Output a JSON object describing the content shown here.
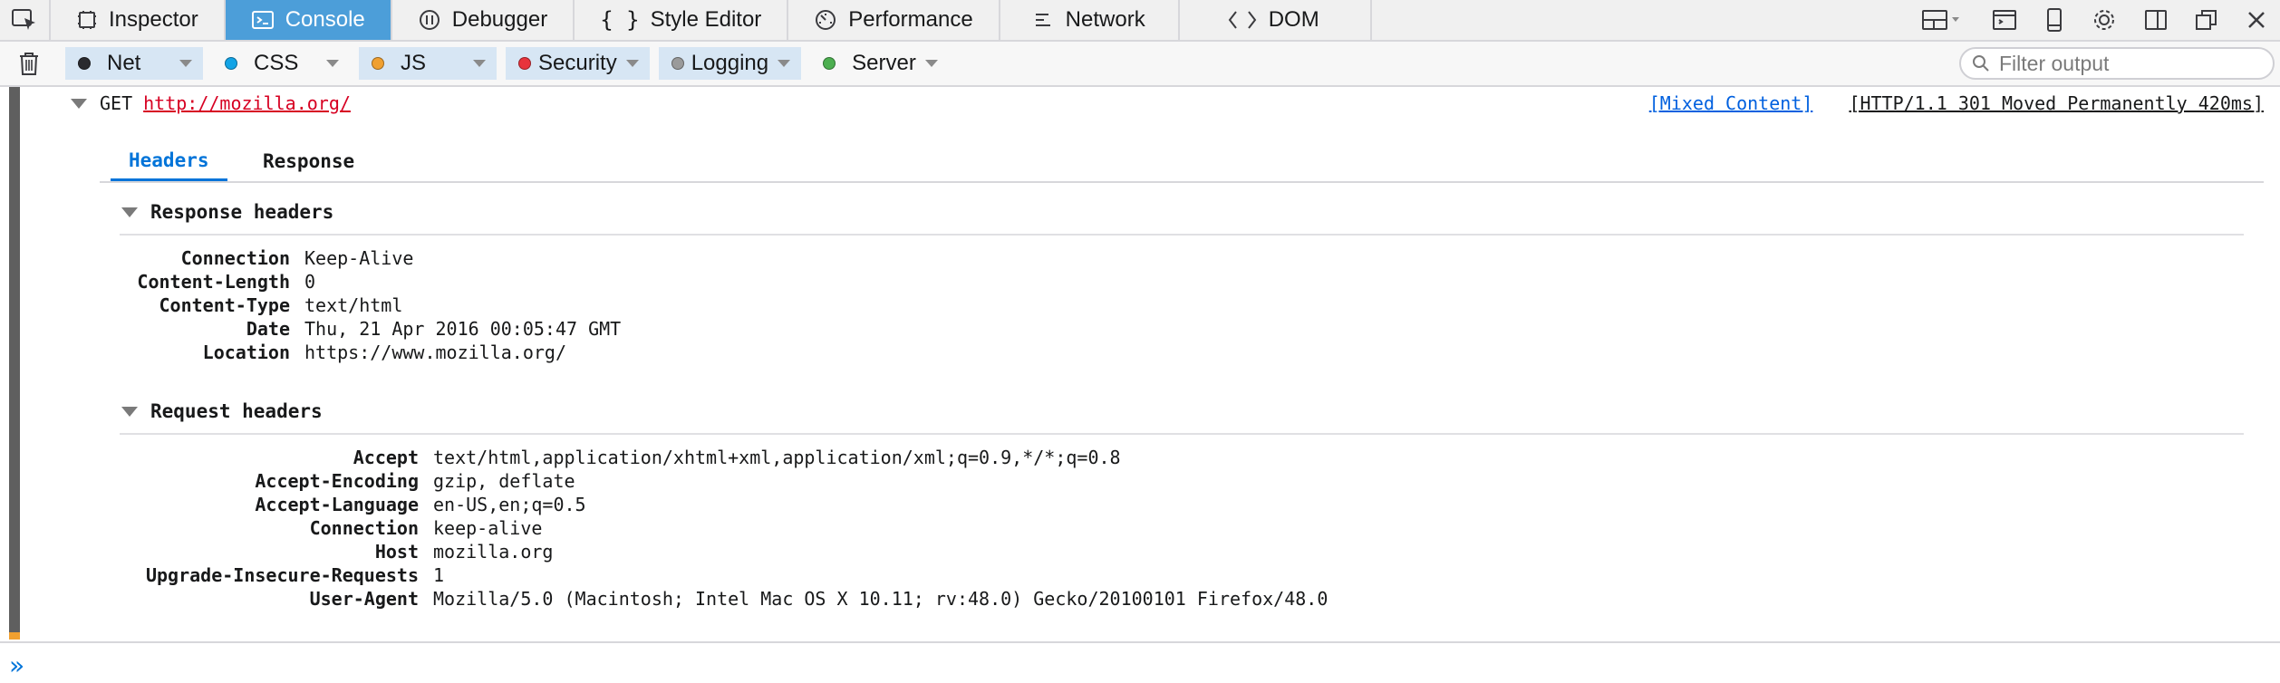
{
  "toolbar": {
    "tabs": [
      {
        "label": "Inspector",
        "icon": "inspector-icon"
      },
      {
        "label": "Console",
        "icon": "console-icon",
        "selected": true
      },
      {
        "label": "Debugger",
        "icon": "debugger-icon"
      },
      {
        "label": "Style Editor",
        "icon": "style-editor-icon"
      },
      {
        "label": "Performance",
        "icon": "performance-icon"
      },
      {
        "label": "Network",
        "icon": "network-icon"
      },
      {
        "label": "DOM",
        "icon": "dom-icon"
      }
    ],
    "right_icons": [
      "dock-layout-icon",
      "split-console-icon",
      "responsive-design-icon",
      "settings-icon",
      "dock-side-icon",
      "undock-window-icon",
      "close-icon"
    ],
    "accent_color": "#4c9ed9"
  },
  "filters": {
    "items": [
      {
        "label": "Net",
        "color": "#2a2a2e",
        "active": true
      },
      {
        "label": "CSS",
        "color": "#13a4e6",
        "active": false
      },
      {
        "label": "JS",
        "color": "#f0a030",
        "active": true
      },
      {
        "label": "Security",
        "color": "#e8333c",
        "active": true
      },
      {
        "label": "Logging",
        "color": "#9a9a9a",
        "active": true
      },
      {
        "label": "Server",
        "color": "#4caf50",
        "active": false
      }
    ],
    "search_placeholder": "Filter output"
  },
  "request": {
    "method": "GET",
    "url": "http://mozilla.org/",
    "mixed_content": "[Mixed Content]",
    "status": "[HTTP/1.1 301 Moved Permanently 420ms]"
  },
  "detail_tabs": {
    "headers": "Headers",
    "response": "Response"
  },
  "response_headers": {
    "title": "Response headers",
    "rows": [
      {
        "name": "Connection",
        "value": "Keep-Alive"
      },
      {
        "name": "Content-Length",
        "value": "0"
      },
      {
        "name": "Content-Type",
        "value": "text/html"
      },
      {
        "name": "Date",
        "value": "Thu, 21 Apr 2016 00:05:47 GMT"
      },
      {
        "name": "Location",
        "value": "https://www.mozilla.org/"
      }
    ]
  },
  "request_headers": {
    "title": "Request headers",
    "rows": [
      {
        "name": "Accept",
        "value": "text/html,application/xhtml+xml,application/xml;q=0.9,*/*;q=0.8"
      },
      {
        "name": "Accept-Encoding",
        "value": "gzip, deflate"
      },
      {
        "name": "Accept-Language",
        "value": "en-US,en;q=0.5"
      },
      {
        "name": "Connection",
        "value": "keep-alive"
      },
      {
        "name": "Host",
        "value": "mozilla.org"
      },
      {
        "name": "Upgrade-Insecure-Requests",
        "value": "1"
      },
      {
        "name": "User-Agent",
        "value": "Mozilla/5.0 (Macintosh; Intel Mac OS X 10.11; rv:48.0) Gecko/20100101 Firefox/48.0"
      }
    ]
  },
  "command_line": {
    "prompt": "»",
    "value": ""
  }
}
